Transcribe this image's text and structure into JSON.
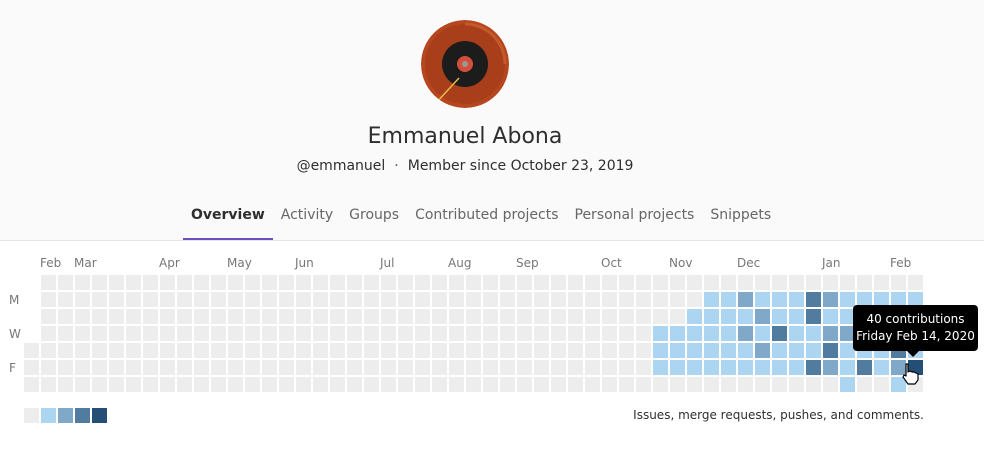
{
  "profile": {
    "name": "Emmanuel Abona",
    "username": "@emmanuel",
    "separator": "·",
    "member_since": "Member since October 23, 2019",
    "avatar_icon": "vinyl-record-avatar"
  },
  "tabs": [
    {
      "label": "Overview",
      "active": true
    },
    {
      "label": "Activity",
      "active": false
    },
    {
      "label": "Groups",
      "active": false
    },
    {
      "label": "Contributed projects",
      "active": false
    },
    {
      "label": "Personal projects",
      "active": false
    },
    {
      "label": "Snippets",
      "active": false
    }
  ],
  "calendar": {
    "months": [
      "Feb",
      "Mar",
      "Apr",
      "May",
      "Jun",
      "Jul",
      "Aug",
      "Sep",
      "Oct",
      "Nov",
      "Dec",
      "Jan",
      "Feb"
    ],
    "day_labels": [
      "M",
      "W",
      "F"
    ],
    "colors": [
      "#ededed",
      "#acd5f2",
      "#7fa8c9",
      "#527ba0",
      "#254e77"
    ],
    "description": "Issues, merge requests, pushes, and comments."
  },
  "tooltip": {
    "line1": "40 contributions",
    "line2": "Friday Feb 14, 2020"
  },
  "tab_underline_color": "#6b4fbb"
}
